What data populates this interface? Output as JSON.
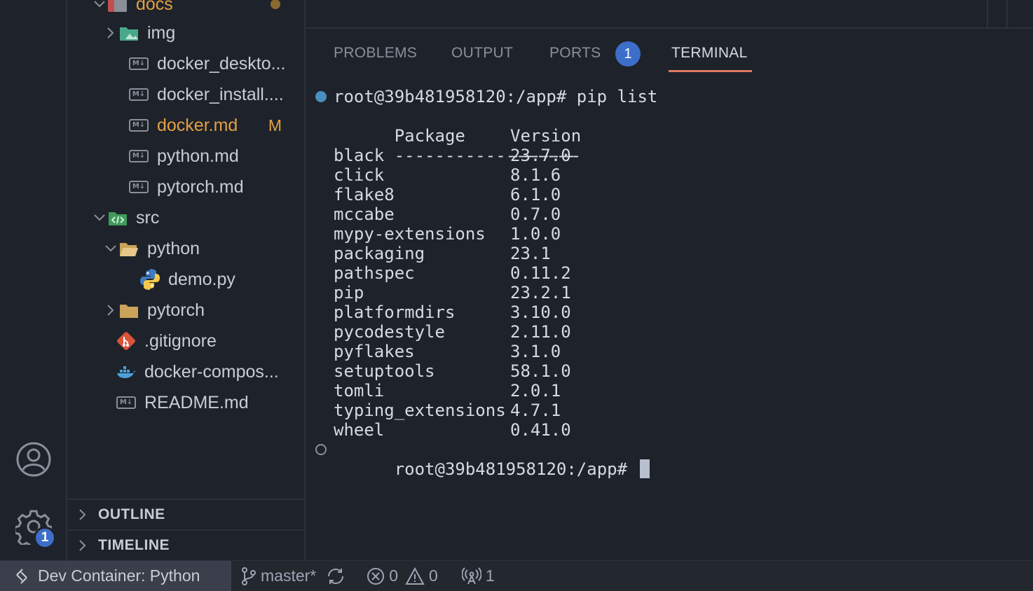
{
  "explorer": {
    "folders": {
      "docs": "docs",
      "img": "img",
      "src": "src",
      "python": "python",
      "pytorch": "pytorch"
    },
    "files": {
      "docker_desktop": "docker_deskto...",
      "docker_install": "docker_install....",
      "docker_md": "docker.md",
      "docker_md_status": "M",
      "python_md": "python.md",
      "pytorch_md": "pytorch.md",
      "demo_py": "demo.py",
      "gitignore": ".gitignore",
      "docker_compose": "docker-compos...",
      "readme": "README.md"
    },
    "sections": {
      "outline": "OUTLINE",
      "timeline": "TIMELINE"
    }
  },
  "activity": {
    "settings_badge": "1"
  },
  "panel": {
    "tabs": {
      "problems": "PROBLEMS",
      "output": "OUTPUT",
      "ports": "PORTS",
      "ports_badge": "1",
      "terminal": "TERMINAL"
    }
  },
  "terminal": {
    "command_line": "root@39b481958120:/app# pip list",
    "header": {
      "package": "Package",
      "version": "Version"
    },
    "separator": {
      "package": "------------------",
      "version": "-------"
    },
    "packages": [
      {
        "name": "black",
        "version": "23.7.0"
      },
      {
        "name": "click",
        "version": "8.1.6"
      },
      {
        "name": "flake8",
        "version": "6.1.0"
      },
      {
        "name": "mccabe",
        "version": "0.7.0"
      },
      {
        "name": "mypy-extensions",
        "version": "1.0.0"
      },
      {
        "name": "packaging",
        "version": "23.1"
      },
      {
        "name": "pathspec",
        "version": "0.11.2"
      },
      {
        "name": "pip",
        "version": "23.2.1"
      },
      {
        "name": "platformdirs",
        "version": "3.10.0"
      },
      {
        "name": "pycodestyle",
        "version": "2.11.0"
      },
      {
        "name": "pyflakes",
        "version": "3.1.0"
      },
      {
        "name": "setuptools",
        "version": "58.1.0"
      },
      {
        "name": "tomli",
        "version": "2.0.1"
      },
      {
        "name": "typing_extensions",
        "version": "4.7.1"
      },
      {
        "name": "wheel",
        "version": "0.41.0"
      }
    ],
    "prompt": "root@39b481958120:/app# "
  },
  "statusbar": {
    "remote": "Dev Container: Python",
    "branch": "master*",
    "errors": "0",
    "warnings": "0",
    "ports": "1"
  },
  "colors": {
    "accent_badge": "#3d6ec9",
    "modified": "#e2a042",
    "active_tab_underline": "#e0795f"
  }
}
